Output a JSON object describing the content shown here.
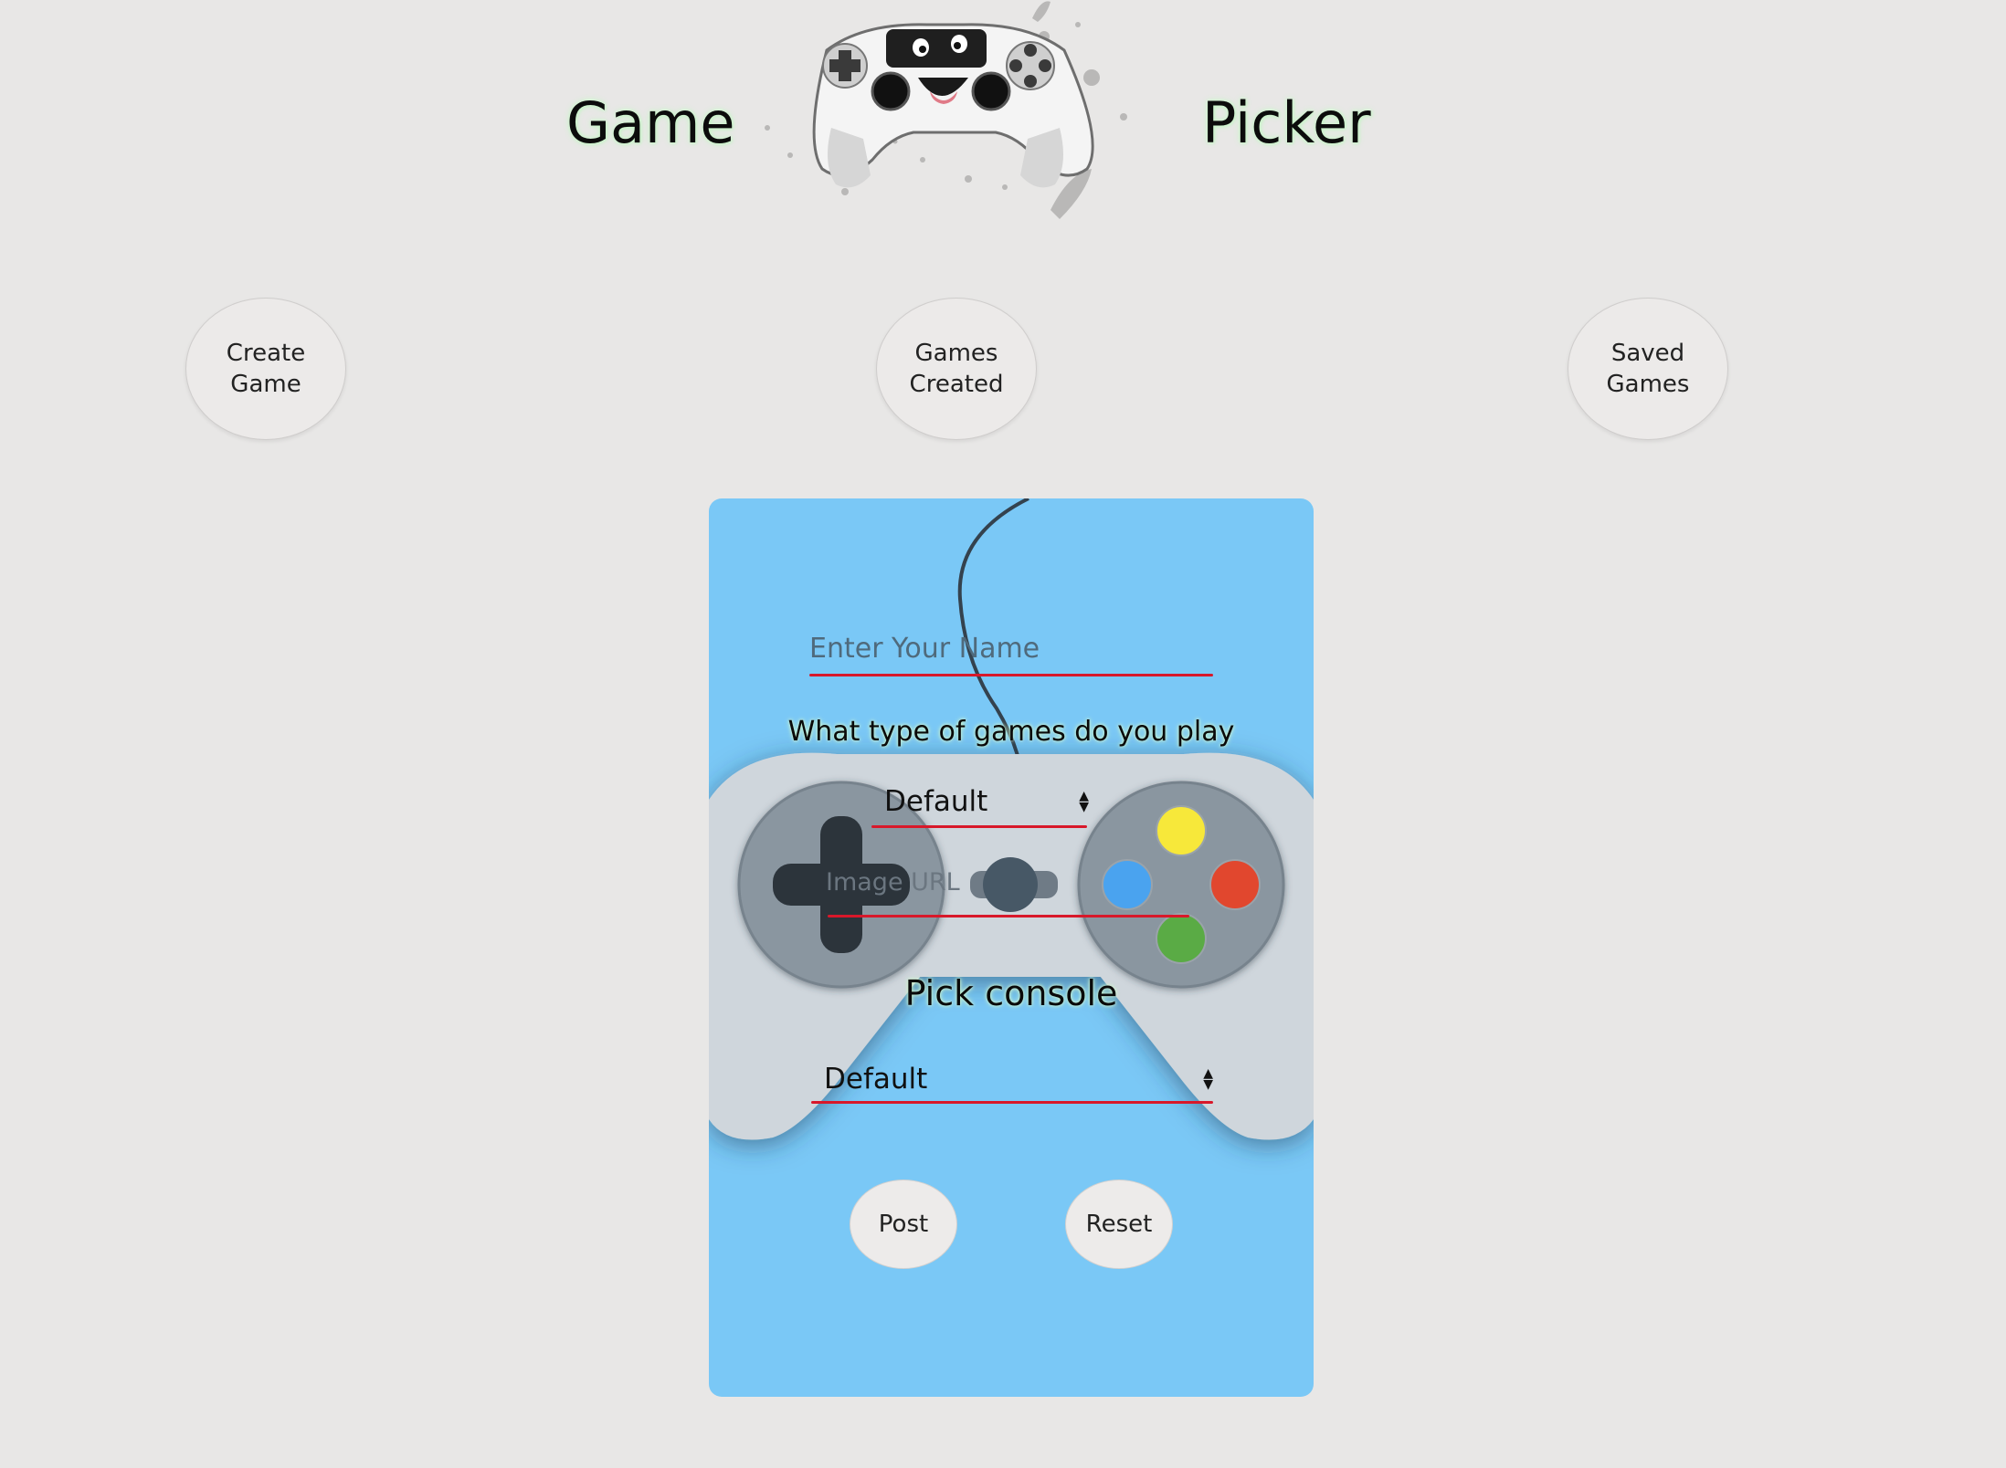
{
  "header": {
    "title_left": "Game",
    "title_right": "Picker",
    "logo_icon": "gamepad-mascot-icon"
  },
  "nav": {
    "create": "Create Game",
    "created": "Games Created",
    "saved": "Saved Games"
  },
  "form": {
    "name_placeholder": "Enter Your Name",
    "type_label": "What type of games do you play",
    "type_select_value": "Default",
    "image_placeholder": "Image URL",
    "console_label": "Pick console",
    "console_select_value": "Default",
    "post_label": "Post",
    "reset_label": "Reset",
    "background_icon": "gamepad-icon"
  },
  "colors": {
    "page_bg": "#e8e7e6",
    "card_bg": "#7ac8f6",
    "underline": "#d8182a",
    "title_glow": "#c9f5c9",
    "btn_yellow": "#f7e83a",
    "btn_blue": "#4aa3ef",
    "btn_red": "#e1472e",
    "btn_green": "#5aab45"
  }
}
